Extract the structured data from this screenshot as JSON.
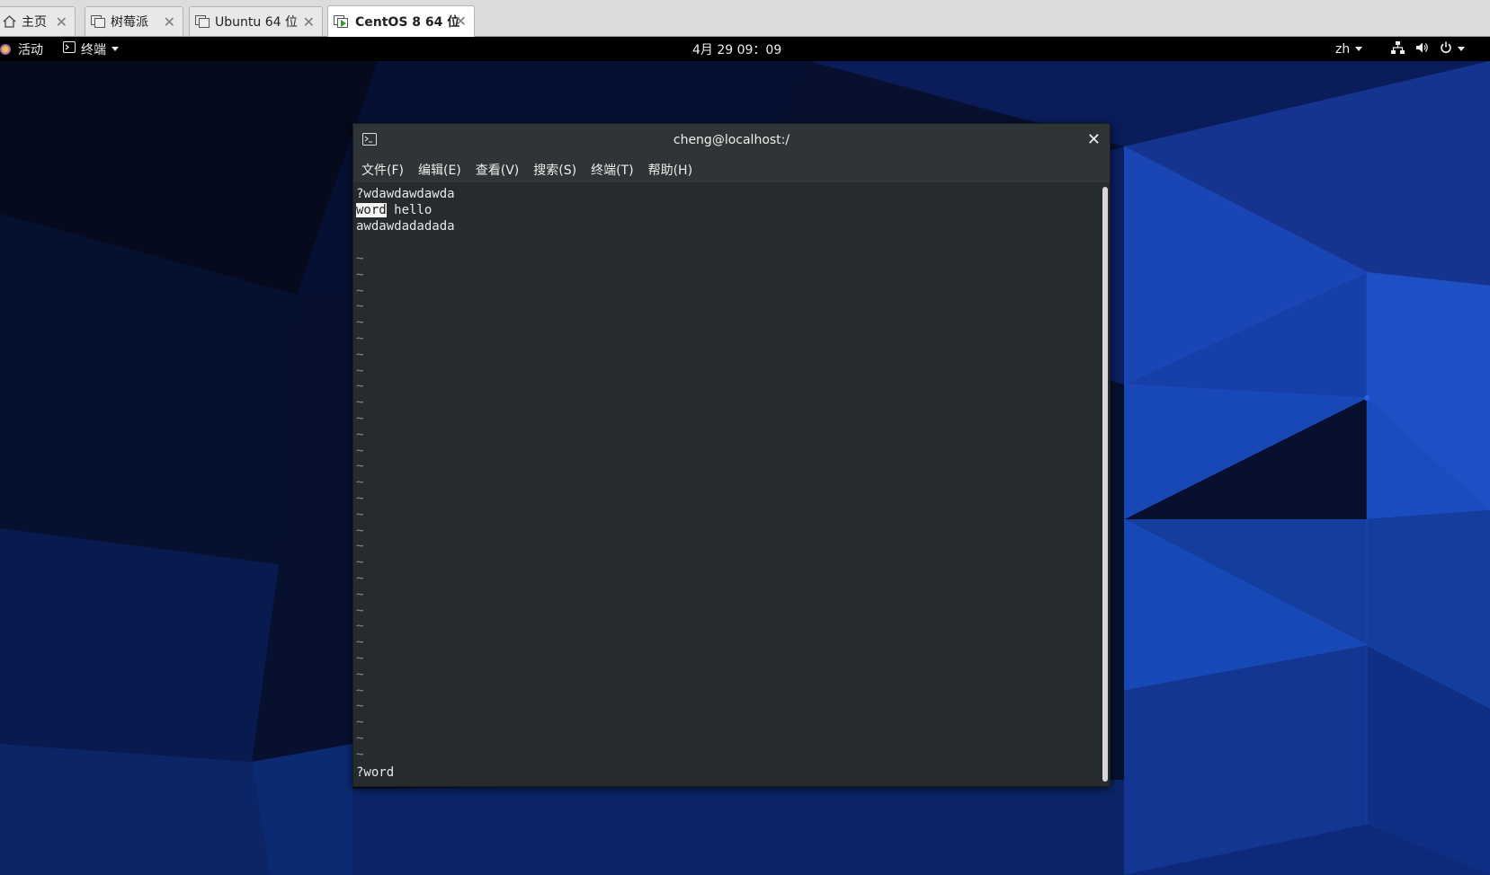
{
  "vm_tabs": [
    {
      "label": "主页",
      "icon": "home-icon"
    },
    {
      "label": "树莓派",
      "icon": "vm-icon"
    },
    {
      "label": "Ubuntu 64 位",
      "icon": "vm-icon"
    },
    {
      "label": "CentOS 8 64 位",
      "icon": "vm-running-icon",
      "active": true
    }
  ],
  "topbar": {
    "activities": "活动",
    "app_menu": "终端",
    "clock": "4月 29 09：09",
    "input_method": "zh"
  },
  "terminal": {
    "title": "cheng@localhost:/",
    "menu": [
      "文件(F)",
      "编辑(E)",
      "查看(V)",
      "搜索(S)",
      "终端(T)",
      "帮助(H)"
    ],
    "lines": {
      "line1": "?wdawdawdawda",
      "line2_match": "word",
      "line2_rest": " hello",
      "line3": "awdawdadadada"
    },
    "tilde": "~",
    "command": "?word"
  },
  "colors": {
    "terminal_bg": "#262b2e",
    "titlebar_bg": "#2f3436",
    "topbar_bg": "#000000",
    "desktop_accent": "#1d4fc4"
  }
}
